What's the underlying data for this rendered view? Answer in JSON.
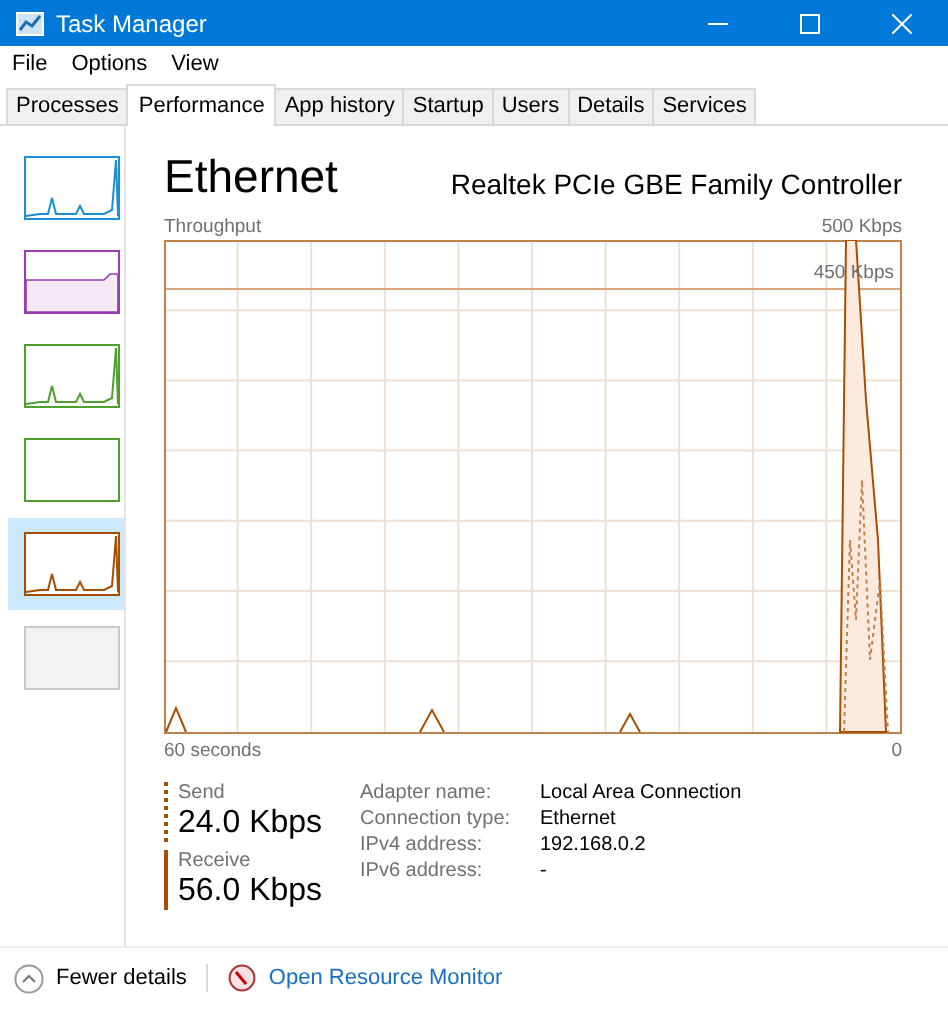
{
  "window": {
    "title": "Task Manager"
  },
  "menu": [
    "File",
    "Options",
    "View"
  ],
  "tabs": [
    {
      "label": "Processes",
      "selected": false
    },
    {
      "label": "Performance",
      "selected": true
    },
    {
      "label": "App history",
      "selected": false
    },
    {
      "label": "Startup",
      "selected": false
    },
    {
      "label": "Users",
      "selected": false
    },
    {
      "label": "Details",
      "selected": false
    },
    {
      "label": "Services",
      "selected": false
    }
  ],
  "sidebar": {
    "items": [
      {
        "kind": "spiky",
        "color": "#1c8ed4",
        "selected": false
      },
      {
        "kind": "filled",
        "color": "#9b3bb4",
        "selected": false
      },
      {
        "kind": "spiky",
        "color": "#4da02b",
        "selected": false
      },
      {
        "kind": "flat",
        "color": "#4da02b",
        "selected": false
      },
      {
        "kind": "spiky",
        "color": "#a74f01",
        "selected": true
      },
      {
        "kind": "empty",
        "color": "#c8c8c8",
        "selected": false
      }
    ]
  },
  "heading": {
    "title": "Ethernet",
    "device": "Realtek PCIe GBE Family Controller"
  },
  "graph": {
    "label": "Throughput",
    "max": "500 Kbps",
    "scale": "450 Kbps",
    "start": "60 seconds",
    "end": "0"
  },
  "stats": [
    {
      "kind": "send",
      "label": "Send",
      "value": "24.0 Kbps"
    },
    {
      "kind": "receive",
      "label": "Receive",
      "value": "56.0 Kbps"
    }
  ],
  "details": [
    {
      "label": "Adapter name:",
      "value": "Local Area Connection"
    },
    {
      "label": "Connection type:",
      "value": "Ethernet"
    },
    {
      "label": "IPv4 address:",
      "value": "192.168.0.2"
    },
    {
      "label": "IPv6 address:",
      "value": "-"
    }
  ],
  "footer": {
    "toggle": "Fewer details",
    "link": "Open Resource Monitor"
  }
}
